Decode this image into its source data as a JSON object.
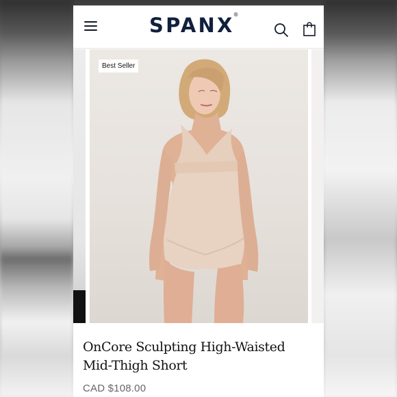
{
  "header": {
    "logo_text": "SPANX",
    "logo_mark": "®",
    "menu_icon": "hamburger-menu-icon",
    "search_icon": "search-icon",
    "bag_icon": "shopping-bag-icon"
  },
  "gallery": {
    "badge": "Best Seller"
  },
  "product": {
    "title": "OnCore Sculpting High-Waisted Mid-Thigh Short",
    "price": "CAD $108.00"
  },
  "colors": {
    "brand_navy": "#10203d",
    "badge_bg": "#ffffff",
    "price_gray": "#666666"
  }
}
